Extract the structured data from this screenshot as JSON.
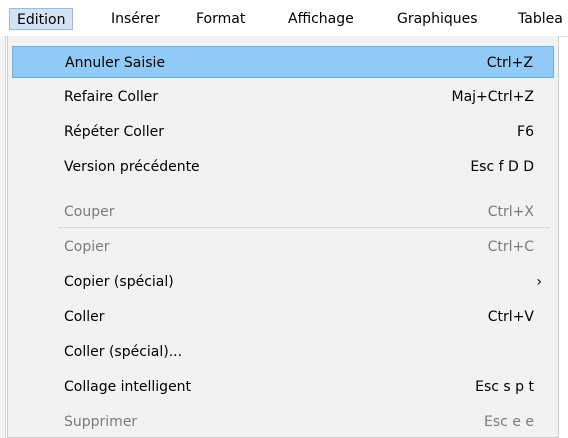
{
  "menubar": {
    "items": [
      "Edition",
      "Insérer",
      "Format",
      "Affichage",
      "Graphiques",
      "Tablea"
    ]
  },
  "menu": {
    "items": [
      {
        "label": "Annuler Saisie",
        "shortcut": "Ctrl+Z",
        "state": "highlighted"
      },
      {
        "label": "Refaire Coller",
        "shortcut": "Maj+Ctrl+Z",
        "state": "enabled"
      },
      {
        "label": "Répéter Coller",
        "shortcut": "F6",
        "state": "enabled"
      },
      {
        "label": "Version précédente",
        "shortcut": "Esc f D D",
        "state": "enabled"
      },
      {
        "label": "Couper",
        "shortcut": "Ctrl+X",
        "state": "disabled"
      },
      {
        "label": "Copier",
        "shortcut": "Ctrl+C",
        "state": "disabled"
      },
      {
        "label": "Copier (spécial)",
        "submenu_glyph": "›",
        "state": "enabled"
      },
      {
        "label": "Coller",
        "shortcut": "Ctrl+V",
        "state": "enabled"
      },
      {
        "label": "Coller (spécial)...",
        "state": "enabled"
      },
      {
        "label": "Collage intelligent",
        "shortcut": "Esc s p t",
        "state": "enabled"
      },
      {
        "label": "Supprimer",
        "shortcut": "Esc e e",
        "state": "disabled"
      }
    ]
  },
  "colors": {
    "highlight": "#91c9f7",
    "active_menubar": "#d4e3f3",
    "disabled_text": "#7a7a7a",
    "menu_background": "#f2f2f2"
  }
}
